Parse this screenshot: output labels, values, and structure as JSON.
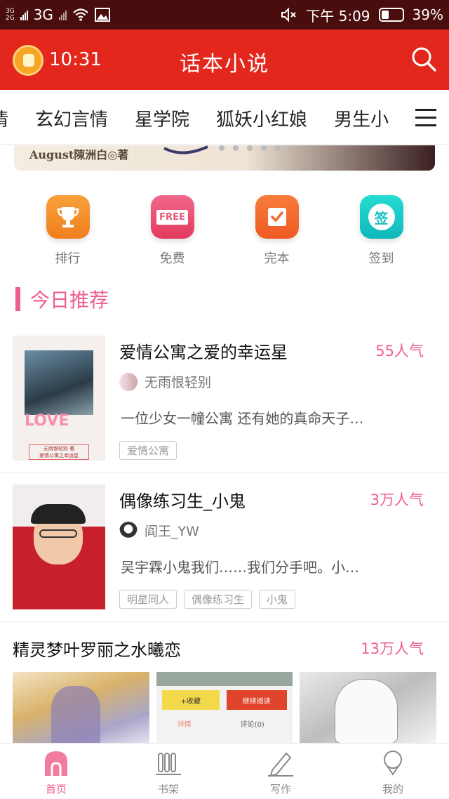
{
  "status_bar": {
    "network_1": "3G",
    "network_2": "2G",
    "network_type": "3G",
    "time_label": "下午 5:09",
    "battery": "39%",
    "battery_level": 0.39
  },
  "header": {
    "timer": "10:31",
    "title": "话本小说"
  },
  "category_tabs": [
    "情",
    "玄幻言情",
    "星学院",
    "狐妖小红娘",
    "男生小"
  ],
  "banner": {
    "caption": "August陳洲白◎著"
  },
  "quick_entries": [
    {
      "label": "排行",
      "icon": "trophy-icon",
      "color": "#f5922b"
    },
    {
      "label": "免费",
      "icon": "free-sign-icon",
      "color": "#ec4d6f",
      "icon_text": "FREE"
    },
    {
      "label": "完本",
      "icon": "check-note-icon",
      "color": "#f46b2b"
    },
    {
      "label": "签到",
      "icon": "sign-in-icon",
      "color": "#17c8c3",
      "icon_text": "签"
    }
  ],
  "section": {
    "title": "今日推荐"
  },
  "books": [
    {
      "title": "爱情公寓之爱的幸运星",
      "popularity": "55人气",
      "author": "无雨恨轻别",
      "description": "一位少女一幢公寓 还有她的真命天子…",
      "tags": [
        "爱情公寓"
      ],
      "cover_text": "LOVE",
      "cover_caption_1": "无雨恨轻别 著",
      "cover_caption_2": "爱情公寓之幸运星"
    },
    {
      "title": "偶像练习生_小鬼",
      "popularity": "3万人气",
      "author": "阎王_YW",
      "description": "吴宇霖小鬼我们……我们分手吧。小…",
      "tags": [
        "明星同人",
        "偶像练习生",
        "小鬼"
      ]
    }
  ],
  "featured": {
    "title": "精灵梦叶罗丽之水曦恋",
    "popularity": "13万人气",
    "thumb_buttons": [
      "+收藏",
      "继续阅读"
    ],
    "thumb_tabs": [
      "详情",
      "评论(0)"
    ]
  },
  "bottom_nav": [
    {
      "label": "首页",
      "icon": "home-icon",
      "active": true
    },
    {
      "label": "书架",
      "icon": "bookshelf-icon",
      "active": false
    },
    {
      "label": "写作",
      "icon": "pen-icon",
      "active": false
    },
    {
      "label": "我的",
      "icon": "profile-icon",
      "active": false
    }
  ],
  "colors": {
    "brand_red": "#e3271c",
    "accent_pink": "#ee5e8c",
    "status_bar": "#4a0d0d"
  }
}
